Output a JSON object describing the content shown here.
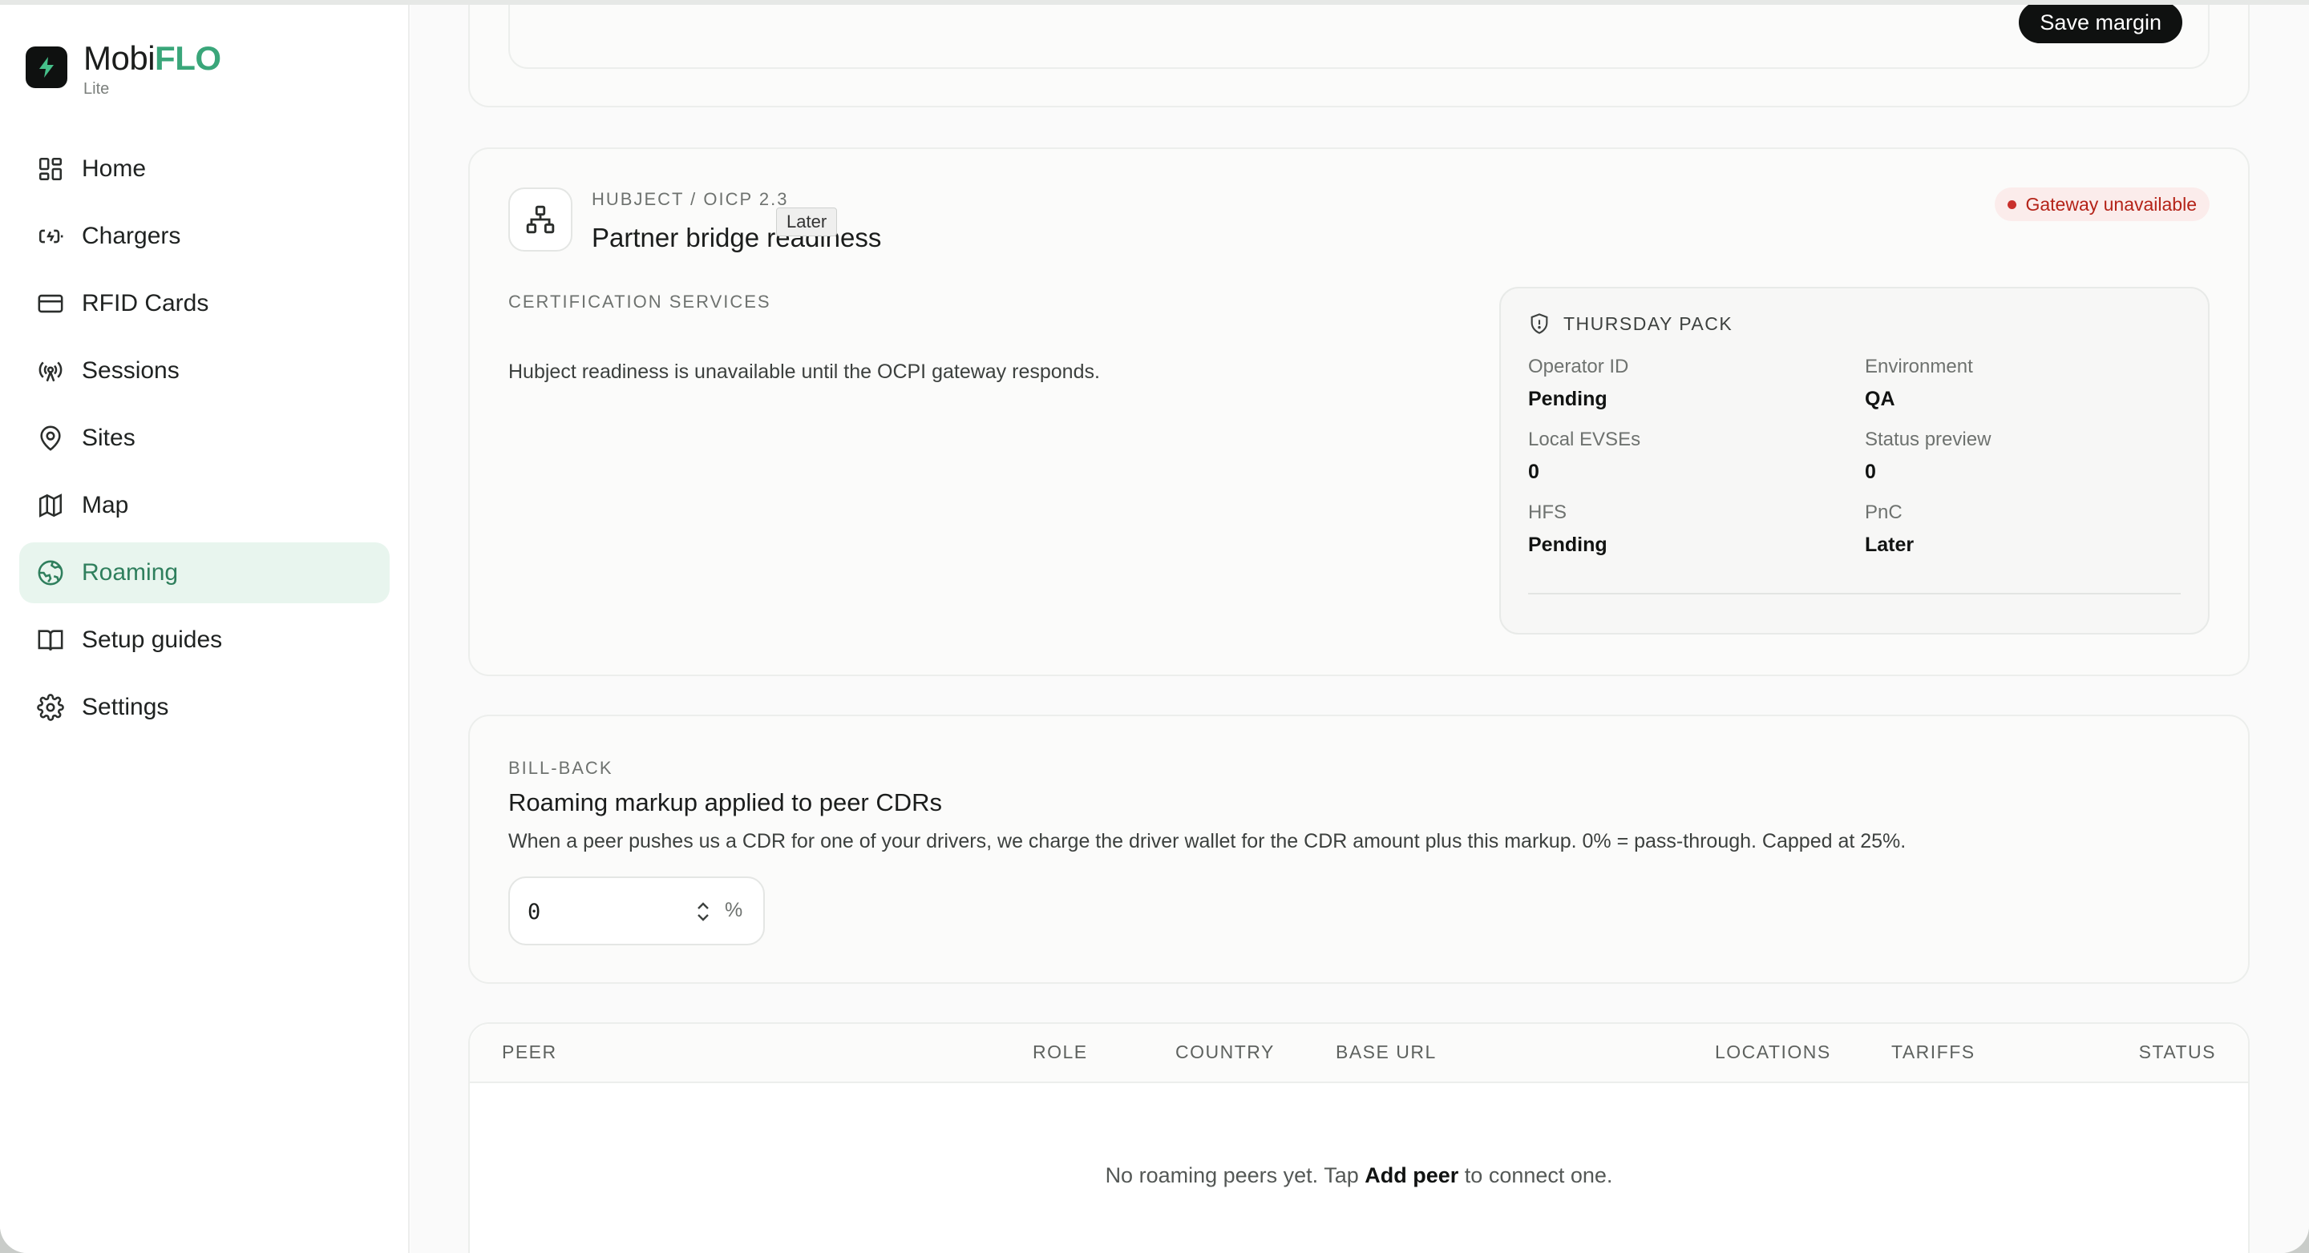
{
  "brand": {
    "name_main": "Mobi",
    "name_accent": "FLO",
    "sub": "Lite"
  },
  "nav": [
    {
      "label": "Home",
      "icon": "home-grid-icon",
      "active": false
    },
    {
      "label": "Chargers",
      "icon": "charger-icon",
      "active": false
    },
    {
      "label": "RFID Cards",
      "icon": "card-icon",
      "active": false
    },
    {
      "label": "Sessions",
      "icon": "broadcast-icon",
      "active": false
    },
    {
      "label": "Sites",
      "icon": "location-pin-icon",
      "active": false
    },
    {
      "label": "Map",
      "icon": "map-icon",
      "active": false
    },
    {
      "label": "Roaming",
      "icon": "globe-icon",
      "active": true
    },
    {
      "label": "Setup guides",
      "icon": "book-icon",
      "active": false
    },
    {
      "label": "Settings",
      "icon": "gear-icon",
      "active": false
    }
  ],
  "margin_card": {
    "save_label": "Save margin"
  },
  "bridge": {
    "eyebrow": "HUBJECT / OICP 2.3",
    "title": "Partner bridge readiness",
    "tooltip": "Later",
    "status_badge": "Gateway unavailable",
    "cert_eyebrow": "CERTIFICATION SERVICES",
    "cert_text": "Hubject readiness is unavailable until the OCPI gateway responds.",
    "pack": {
      "title": "THURSDAY PACK",
      "fields": [
        {
          "label": "Operator ID",
          "value": "Pending"
        },
        {
          "label": "Environment",
          "value": "QA"
        },
        {
          "label": "Local EVSEs",
          "value": "0"
        },
        {
          "label": "Status preview",
          "value": "0"
        },
        {
          "label": "HFS",
          "value": "Pending"
        },
        {
          "label": "PnC",
          "value": "Later"
        }
      ]
    }
  },
  "billback": {
    "eyebrow": "BILL-BACK",
    "title": "Roaming markup applied to peer CDRs",
    "description": "When a peer pushes us a CDR for one of your drivers, we charge the driver wallet for the CDR amount plus this markup. 0% = pass-through. Capped at 25%.",
    "markup_value": "0",
    "unit": "%"
  },
  "peers_table": {
    "columns": [
      "PEER",
      "ROLE",
      "COUNTRY",
      "BASE URL",
      "LOCATIONS",
      "TARIFFS",
      "STATUS"
    ],
    "empty_prefix": "No roaming peers yet. Tap",
    "empty_action": "Add peer",
    "empty_suffix": "to connect one."
  },
  "colors": {
    "accent": "#3aa67a",
    "active_bg": "#e8f5ee",
    "danger": "#b42318"
  }
}
